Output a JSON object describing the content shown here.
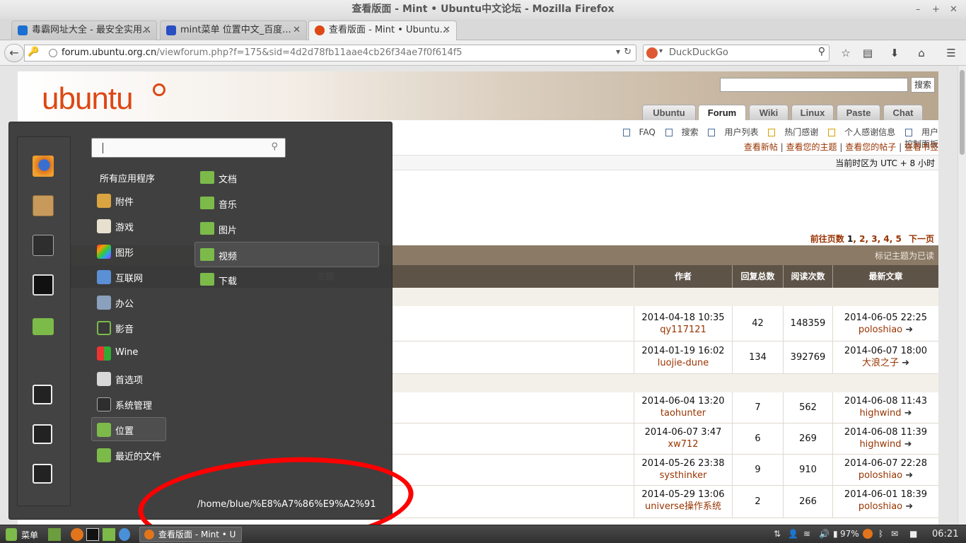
{
  "window": {
    "title": "查看版面 - Mint • Ubuntu中文论坛 - Mozilla Firefox",
    "minimize": "–",
    "maximize": "+",
    "close": "✕"
  },
  "browser_tabs": [
    {
      "label": "毒霸网址大全 - 最安全实用...",
      "close": "✕",
      "icon_color": "#1a6fd1"
    },
    {
      "label": "mint菜单 位置中文_百度...",
      "close": "✕",
      "icon_color": "#2a4fc2"
    },
    {
      "label": "查看版面 - Mint • Ubuntu...",
      "close": "✕",
      "icon_color": "#dd4814",
      "active": true
    }
  ],
  "new_tab": "+",
  "address": {
    "url_host": "forum.ubuntu.org.cn",
    "url_path": "/viewforum.php?f=175&sid=4d2d78fb11aae4cb26f34ae7f0f614f5",
    "dropdown": "▾",
    "reload": "↻"
  },
  "search_engine": {
    "placeholder": "DuckDuckGo",
    "dropdown": "▾",
    "icon": "search-icon"
  },
  "toolbar_icons": [
    "bookmark-star-icon",
    "reading-list-icon",
    "download-icon",
    "home-icon",
    "menu-icon"
  ],
  "site": {
    "logo": "ubuntu",
    "search_button": "搜索",
    "nav_tabs": [
      "Ubuntu",
      "Forum",
      "Wiki",
      "Linux",
      "Paste",
      "Chat"
    ],
    "active_tab": "Forum",
    "top_links": [
      "FAQ",
      "搜索",
      "用户列表",
      "热门感谢",
      "个人感谢信息",
      "用户控制面板"
    ],
    "user_links": [
      "查看新帖",
      "查看您的主题",
      "查看您的帖子",
      "查看书签"
    ],
    "link_separator": "|",
    "timezone": "当前时区为 UTC + 8 小时",
    "pagination": {
      "prefix": "前往页数",
      "current": "1",
      "pages": [
        "2",
        "3",
        "4",
        "5"
      ],
      "next": "下一页"
    },
    "mark_read": "标记主题为已读",
    "table_headers": {
      "topic": "主题",
      "author": "作者",
      "replies": "回复总数",
      "views": "阅读次数",
      "last": "最新文章"
    },
    "rows": [
      {
        "author_date": "2014-04-18 10:35",
        "author": "qy117121",
        "replies": "42",
        "views": "148359",
        "last_date": "2014-06-05 22:25",
        "last_user": "poloshiao"
      },
      {
        "author_date": "2014-01-19 16:02",
        "author": "luojie-dune",
        "replies": "134",
        "views": "392769",
        "last_date": "2014-06-07 18:00",
        "last_user": "大浪之子"
      },
      {
        "author_date": "2014-06-04 13:20",
        "author": "taohunter",
        "replies": "7",
        "views": "562",
        "last_date": "2014-06-08 11:43",
        "last_user": "highwind"
      },
      {
        "author_date": "2014-06-07 3:47",
        "author": "xw712",
        "replies": "6",
        "views": "269",
        "last_date": "2014-06-08 11:39",
        "last_user": "highwind"
      },
      {
        "author_date": "2014-05-26 23:38",
        "author": "systhinker",
        "replies": "9",
        "views": "910",
        "last_date": "2014-06-07 22:28",
        "last_user": "poloshiao"
      },
      {
        "author_date": "2014-05-29 13:06",
        "author": "universe操作系统",
        "replies": "2",
        "views": "266",
        "last_date": "2014-06-01 18:39",
        "last_user": "poloshiao"
      }
    ],
    "goto_icon": "➜"
  },
  "mint_menu": {
    "search_placeholder": "",
    "all_apps": "所有应用程序",
    "categories": [
      "附件",
      "游戏",
      "图形",
      "互联网",
      "办公",
      "影音",
      "Wine",
      "首选项",
      "系统管理",
      "位置",
      "最近的文件"
    ],
    "selected_category": "位置",
    "places": [
      "文档",
      "音乐",
      "图片",
      "视频",
      "下载"
    ],
    "selected_place": "视频",
    "tooltip_path": "/home/blue/%E8%A7%86%E9%A2%91",
    "favorites": [
      "firefox-icon",
      "package-icon",
      "settings-icon",
      "terminal-icon",
      "folder-icon",
      "lock-icon",
      "logout-icon",
      "power-icon"
    ]
  },
  "taskbar": {
    "menu_label": "菜单",
    "task_label": "查看版面 - Mint • U",
    "battery": "97%",
    "clock": "06:21"
  }
}
